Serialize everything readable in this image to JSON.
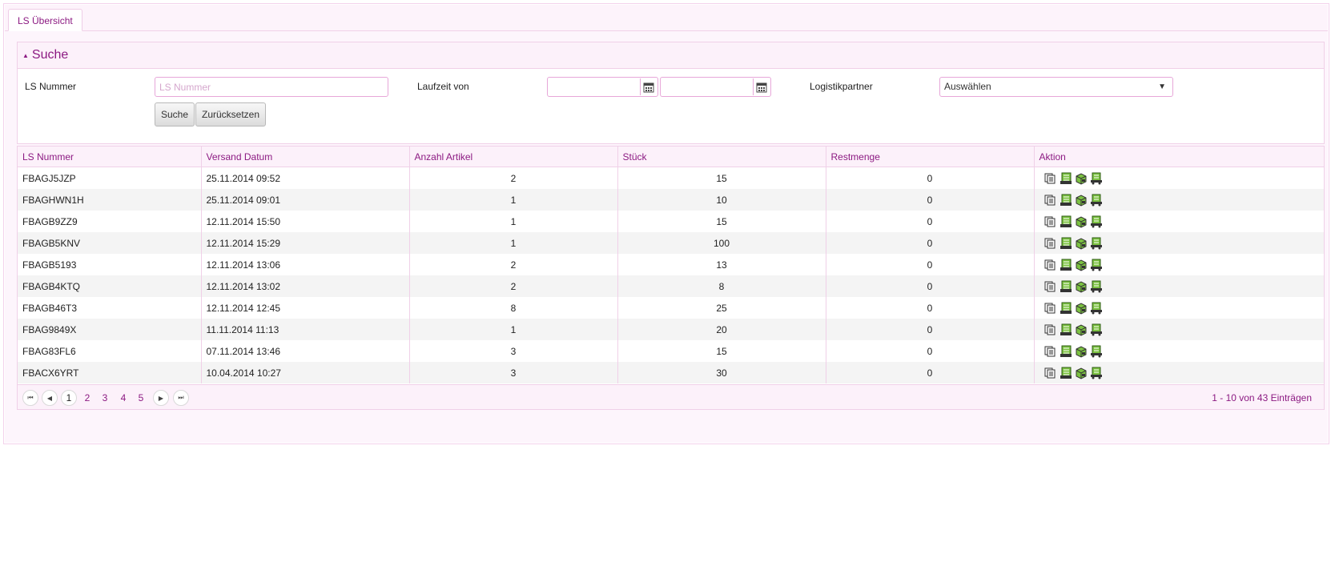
{
  "tabs": [
    {
      "label": "LS Übersicht"
    }
  ],
  "search": {
    "title": "Suche",
    "ls_label": "LS Nummer",
    "ls_placeholder": "LS Nummer",
    "ls_value": "",
    "laufzeit_label": "Laufzeit von",
    "date_from": "",
    "date_to": "",
    "partner_label": "Logistikpartner",
    "partner_value": "Auswählen",
    "search_button": "Suche",
    "reset_button": "Zurücksetzen"
  },
  "table": {
    "columns": [
      "LS Nummer",
      "Versand Datum",
      "Anzahl Artikel",
      "Stück",
      "Restmenge",
      "Aktion"
    ],
    "rows": [
      {
        "ls": "FBAGJ5JZP",
        "date": "25.11.2014 09:52",
        "articles": "2",
        "pieces": "15",
        "rest": "0"
      },
      {
        "ls": "FBAGHWN1H",
        "date": "25.11.2014 09:01",
        "articles": "1",
        "pieces": "10",
        "rest": "0"
      },
      {
        "ls": "FBAGB9ZZ9",
        "date": "12.11.2014 15:50",
        "articles": "1",
        "pieces": "15",
        "rest": "0"
      },
      {
        "ls": "FBAGB5KNV",
        "date": "12.11.2014 15:29",
        "articles": "1",
        "pieces": "100",
        "rest": "0"
      },
      {
        "ls": "FBAGB5193",
        "date": "12.11.2014 13:06",
        "articles": "2",
        "pieces": "13",
        "rest": "0"
      },
      {
        "ls": "FBAGB4KTQ",
        "date": "12.11.2014 13:02",
        "articles": "2",
        "pieces": "8",
        "rest": "0"
      },
      {
        "ls": "FBAGB46T3",
        "date": "12.11.2014 12:45",
        "articles": "8",
        "pieces": "25",
        "rest": "0"
      },
      {
        "ls": "FBAG9849X",
        "date": "11.11.2014 11:13",
        "articles": "1",
        "pieces": "20",
        "rest": "0"
      },
      {
        "ls": "FBAG83FL6",
        "date": "07.11.2014 13:46",
        "articles": "3",
        "pieces": "15",
        "rest": "0"
      },
      {
        "ls": "FBACX6YRT",
        "date": "10.04.2014 10:27",
        "articles": "3",
        "pieces": "30",
        "rest": "0"
      }
    ],
    "action_icons": [
      "documents-icon",
      "green-list-icon",
      "package-icon",
      "green-truck-list-icon"
    ]
  },
  "pager": {
    "pages": [
      "1",
      "2",
      "3",
      "4",
      "5"
    ],
    "current": "1",
    "info": "1 - 10 von 43 Einträgen"
  },
  "colors": {
    "accent": "#8c1a82",
    "border": "#f0d0e8",
    "header_bg": "#fcf1fa",
    "alt_row": "#f4f4f4"
  }
}
